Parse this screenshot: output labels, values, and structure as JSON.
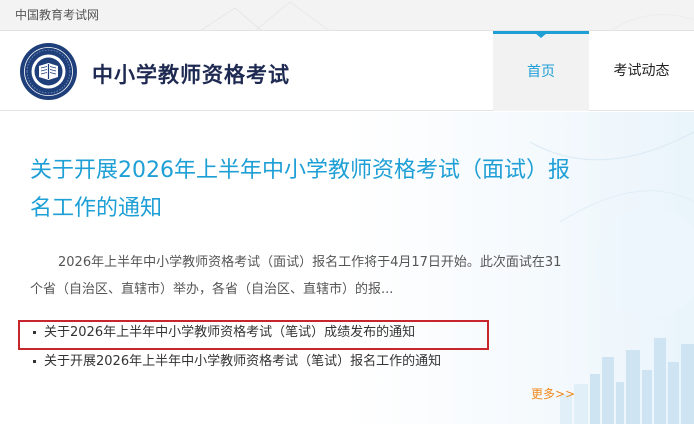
{
  "topbar": {
    "site_name": "中国教育考试网"
  },
  "header": {
    "title": "中小学教师资格考试",
    "nav": {
      "home": "首页",
      "news": "考试动态"
    }
  },
  "main": {
    "headline": "关于开展2026年上半年中小学教师资格考试（面试）报名工作的通知",
    "summary": "2026年上半年中小学教师资格考试（面试）报名工作将于4月17日开始。此次面试在31个省（自治区、直辖市）举办，各省（自治区、直辖市）的报...",
    "news_items": [
      {
        "title": "关于2026年上半年中小学教师资格考试（笔试）成绩发布的通知"
      },
      {
        "title": "关于开展2026年上半年中小学教师资格考试（笔试）报名工作的通知"
      }
    ],
    "more": "更多>>"
  },
  "colors": {
    "accent": "#1e9fd6",
    "title_navy": "#1f2a52",
    "highlight": "#c7272c",
    "more_orange": "#f08a1c"
  },
  "icons": {
    "logo": "education-emblem-icon"
  }
}
